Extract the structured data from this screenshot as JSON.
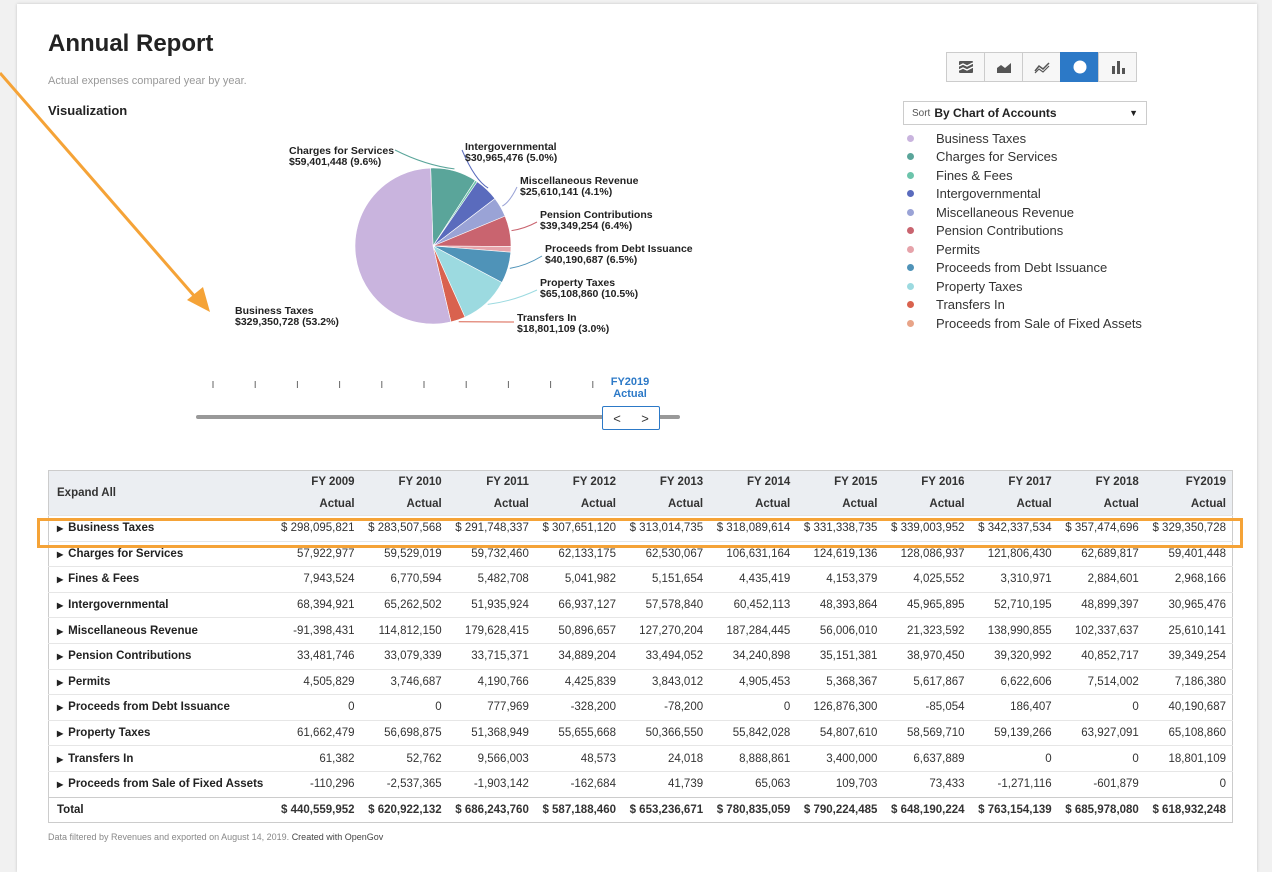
{
  "header": {
    "title": "Annual Report",
    "subtitle": "Actual expenses compared year by year.",
    "viz_label": "Visualization"
  },
  "toolbar": {
    "buttons": [
      {
        "name": "stacked-area-chart-icon",
        "active": false
      },
      {
        "name": "area-chart-icon",
        "active": false
      },
      {
        "name": "line-chart-icon",
        "active": false
      },
      {
        "name": "pie-chart-icon",
        "active": true
      },
      {
        "name": "bar-chart-icon",
        "active": false
      }
    ]
  },
  "sort": {
    "prefix": "Sort",
    "value": "By Chart of Accounts"
  },
  "colors": {
    "accent": "#2c79c7",
    "highlight": "#f5a337",
    "Business Taxes": "#c9b4de",
    "Charges for Services": "#5aa59a",
    "Fines & Fees": "#6cc4ab",
    "Intergovernmental": "#5a6bbd",
    "Miscellaneous Revenue": "#9aa3d6",
    "Pension Contributions": "#c9646f",
    "Permits": "#e6a3aa",
    "Proceeds from Debt Issuance": "#4f93b8",
    "Property Taxes": "#9cdae0",
    "Transfers In": "#d9624e",
    "Proceeds from Sale of Fixed Assets": "#e8a488"
  },
  "legend": [
    "Business Taxes",
    "Charges for Services",
    "Fines & Fees",
    "Intergovernmental",
    "Miscellaneous Revenue",
    "Pension Contributions",
    "Permits",
    "Proceeds from Debt Issuance",
    "Property Taxes",
    "Transfers In",
    "Proceeds from Sale of Fixed Assets"
  ],
  "chart_data": {
    "type": "pie",
    "slices": [
      {
        "label": "Charges for Services",
        "value": 59401448,
        "text": "$59,401,448 (9.6%)"
      },
      {
        "label": "Fines & Fees",
        "value": 2968166,
        "text": ""
      },
      {
        "label": "Intergovernmental",
        "value": 30965476,
        "text": "$30,965,476 (5.0%)"
      },
      {
        "label": "Miscellaneous Revenue",
        "value": 25610141,
        "text": "$25,610,141 (4.1%)"
      },
      {
        "label": "Pension Contributions",
        "value": 39349254,
        "text": "$39,349,254 (6.4%)"
      },
      {
        "label": "Permits",
        "value": 7186380,
        "text": ""
      },
      {
        "label": "Proceeds from Debt Issuance",
        "value": 40190687,
        "text": "$40,190,687 (6.5%)"
      },
      {
        "label": "Property Taxes",
        "value": 65108860,
        "text": "$65,108,860 (10.5%)"
      },
      {
        "label": "Transfers In",
        "value": 18801109,
        "text": "$18,801,109 (3.0%)"
      },
      {
        "label": "Proceeds from Sale of Fixed Assets",
        "value": 0,
        "text": ""
      },
      {
        "label": "Business Taxes",
        "value": 329350728,
        "text": "$329,350,728 (53.2%)"
      }
    ]
  },
  "timeline": {
    "selected_line1": "FY2019",
    "selected_line2": "Actual",
    "prev": "<",
    "next": ">",
    "tick_count": 10
  },
  "table": {
    "expand_label": "Expand All",
    "years": [
      "FY 2009",
      "FY 2010",
      "FY 2011",
      "FY 2012",
      "FY 2013",
      "FY 2014",
      "FY 2015",
      "FY 2016",
      "FY 2017",
      "FY 2018",
      "FY2019"
    ],
    "subheader": "Actual",
    "rows": [
      {
        "label": "Business Taxes",
        "values": [
          "$ 298,095,821",
          "$ 283,507,568",
          "$ 291,748,337",
          "$ 307,651,120",
          "$ 313,014,735",
          "$ 318,089,614",
          "$ 331,338,735",
          "$ 339,003,952",
          "$ 342,337,534",
          "$ 357,474,696",
          "$ 329,350,728"
        ]
      },
      {
        "label": "Charges for Services",
        "values": [
          "57,922,977",
          "59,529,019",
          "59,732,460",
          "62,133,175",
          "62,530,067",
          "106,631,164",
          "124,619,136",
          "128,086,937",
          "121,806,430",
          "62,689,817",
          "59,401,448"
        ]
      },
      {
        "label": "Fines & Fees",
        "values": [
          "7,943,524",
          "6,770,594",
          "5,482,708",
          "5,041,982",
          "5,151,654",
          "4,435,419",
          "4,153,379",
          "4,025,552",
          "3,310,971",
          "2,884,601",
          "2,968,166"
        ]
      },
      {
        "label": "Intergovernmental",
        "values": [
          "68,394,921",
          "65,262,502",
          "51,935,924",
          "66,937,127",
          "57,578,840",
          "60,452,113",
          "48,393,864",
          "45,965,895",
          "52,710,195",
          "48,899,397",
          "30,965,476"
        ]
      },
      {
        "label": "Miscellaneous Revenue",
        "values": [
          "-91,398,431",
          "114,812,150",
          "179,628,415",
          "50,896,657",
          "127,270,204",
          "187,284,445",
          "56,006,010",
          "21,323,592",
          "138,990,855",
          "102,337,637",
          "25,610,141"
        ]
      },
      {
        "label": "Pension Contributions",
        "values": [
          "33,481,746",
          "33,079,339",
          "33,715,371",
          "34,889,204",
          "33,494,052",
          "34,240,898",
          "35,151,381",
          "38,970,450",
          "39,320,992",
          "40,852,717",
          "39,349,254"
        ]
      },
      {
        "label": "Permits",
        "values": [
          "4,505,829",
          "3,746,687",
          "4,190,766",
          "4,425,839",
          "3,843,012",
          "4,905,453",
          "5,368,367",
          "5,617,867",
          "6,622,606",
          "7,514,002",
          "7,186,380"
        ]
      },
      {
        "label": "Proceeds from Debt Issuance",
        "values": [
          "0",
          "0",
          "777,969",
          "-328,200",
          "-78,200",
          "0",
          "126,876,300",
          "-85,054",
          "186,407",
          "0",
          "40,190,687"
        ]
      },
      {
        "label": "Property Taxes",
        "values": [
          "61,662,479",
          "56,698,875",
          "51,368,949",
          "55,655,668",
          "50,366,550",
          "55,842,028",
          "54,807,610",
          "58,569,710",
          "59,139,266",
          "63,927,091",
          "65,108,860"
        ]
      },
      {
        "label": "Transfers In",
        "values": [
          "61,382",
          "52,762",
          "9,566,003",
          "48,573",
          "24,018",
          "8,888,861",
          "3,400,000",
          "6,637,889",
          "0",
          "0",
          "18,801,109"
        ]
      },
      {
        "label": "Proceeds from Sale of Fixed Assets",
        "values": [
          "-110,296",
          "-2,537,365",
          "-1,903,142",
          "-162,684",
          "41,739",
          "65,063",
          "109,703",
          "73,433",
          "-1,271,116",
          "-601,879",
          "0"
        ]
      }
    ],
    "total": {
      "label": "Total",
      "values": [
        "$ 440,559,952",
        "$ 620,922,132",
        "$ 686,243,760",
        "$ 587,188,460",
        "$ 653,236,671",
        "$ 780,835,059",
        "$ 790,224,485",
        "$ 648,190,224",
        "$ 763,154,139",
        "$ 685,978,080",
        "$ 618,932,248"
      ]
    }
  },
  "footer": {
    "text": "Data filtered by Revenues and exported on August 14, 2019.",
    "created": "Created with OpenGov"
  }
}
